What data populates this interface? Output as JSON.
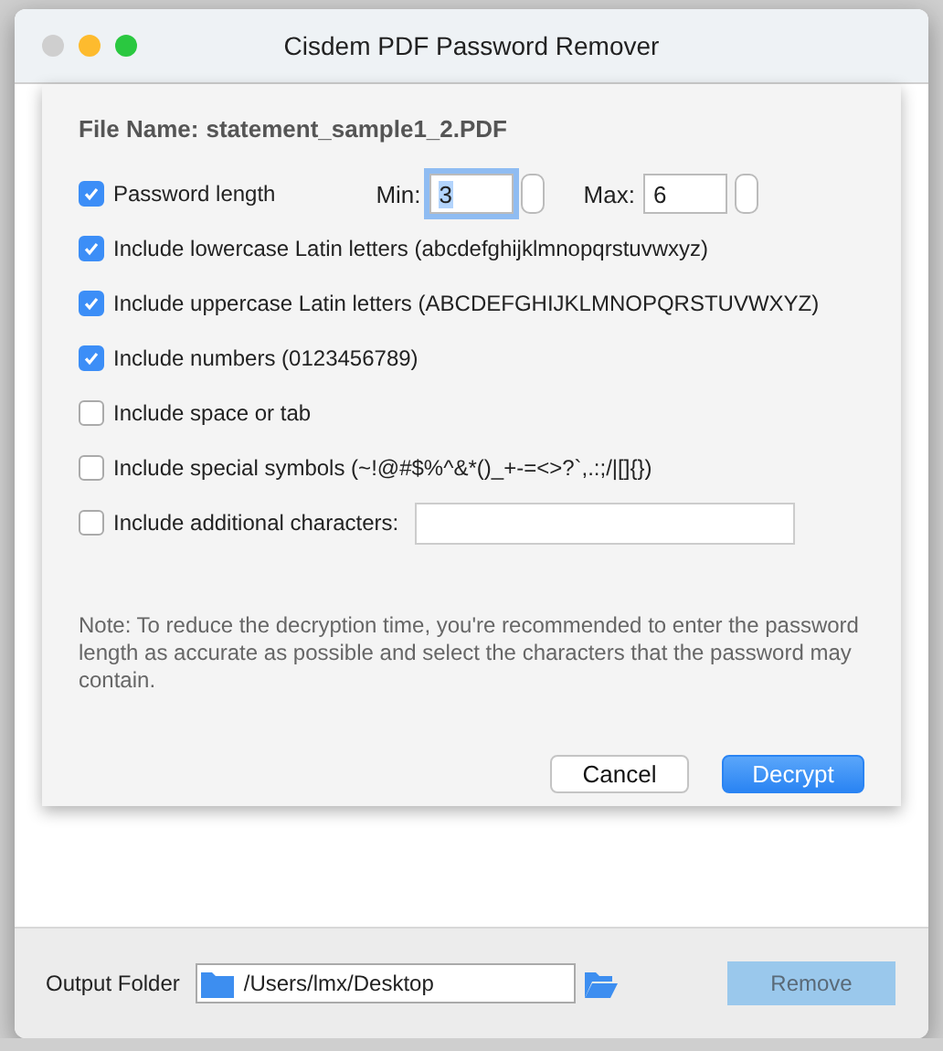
{
  "window": {
    "title": "Cisdem PDF Password Remover"
  },
  "dialog": {
    "file_label": "File Name:",
    "file_name": "statement_sample1_2.PDF",
    "options": [
      {
        "kind": "length",
        "label": "Password length",
        "checked": true,
        "min_label": "Min:",
        "min_value": "3",
        "min_focused": true,
        "max_label": "Max:",
        "max_value": "6"
      },
      {
        "kind": "check",
        "label": "Include lowercase Latin letters (abcdefghijklmnopqrstuvwxyz)",
        "checked": true
      },
      {
        "kind": "check",
        "label": "Include uppercase Latin letters (ABCDEFGHIJKLMNOPQRSTUVWXYZ)",
        "checked": true
      },
      {
        "kind": "check",
        "label": "Include numbers (0123456789)",
        "checked": true
      },
      {
        "kind": "check",
        "label": "Include space or tab",
        "checked": false
      },
      {
        "kind": "check",
        "label": "Include special symbols (~!@#$%^&*()_+-=<>?`,.:;/|[]{})",
        "checked": false
      },
      {
        "kind": "check_input",
        "label": "Include additional characters:",
        "checked": false
      }
    ],
    "note": "Note: To reduce the decryption time, you're recommended to enter the password length as accurate as possible and select the characters that the password may contain.",
    "buttons": [
      {
        "label": "Cancel",
        "kind": "default"
      },
      {
        "label": "Decrypt",
        "kind": "primary"
      }
    ]
  },
  "output": {
    "label": "Output Folder",
    "path": "/Users/lmx/Desktop"
  },
  "remove_button": {
    "label": "Remove",
    "disabled": true
  }
}
